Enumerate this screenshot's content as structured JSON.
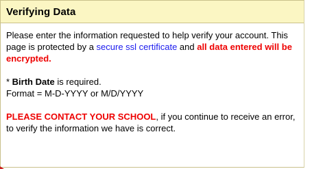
{
  "panel": {
    "title": "Verifying Data",
    "intro": {
      "text_before_link": "Please enter the information requested to help verify your account. This page is protected by a ",
      "link_text": "secure ssl certificate",
      "text_after_link": " and ",
      "alert_text": "all data entered will be encrypted."
    },
    "birth_date": {
      "asterisk": "* ",
      "label": "Birth Date",
      "required_text": " is required.",
      "format_text": "Format = M-D-YYYY or M/D/YYYY"
    },
    "contact": {
      "alert_text": "PLEASE CONTACT YOUR SCHOOL",
      "rest_text": ", if you continue to receive an error, to verify the information we have is correct."
    }
  },
  "colors": {
    "header_background": "#fbf6c3",
    "border": "#c9c08a",
    "link": "#1a1aee",
    "alert": "#ee0000"
  }
}
